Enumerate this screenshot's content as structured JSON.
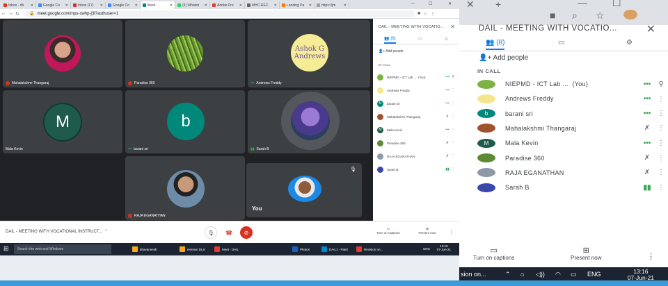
{
  "browser": {
    "tabs": [
      {
        "label": "Inbox - dh",
        "color": "#d93025"
      },
      {
        "label": "Google Co",
        "color": "#4285f4"
      },
      {
        "label": "Inbox (17)",
        "color": "#d93025"
      },
      {
        "label": "Google Co",
        "color": "#4285f4"
      },
      {
        "label": "Meet -",
        "color": "#00897b"
      },
      {
        "label": "(9) Whatsh",
        "color": "#25d366"
      },
      {
        "label": "Adobe Pro",
        "color": "#e53935"
      },
      {
        "label": "MHC-REC",
        "color": "#616161"
      },
      {
        "label": "Landing Pa",
        "color": "#f57c00"
      },
      {
        "label": "https://jm",
        "color": "#9e9e9e"
      }
    ],
    "url": "meet.google.com/mps-swhp-j3l?authuser=1"
  },
  "meet": {
    "tiles": [
      {
        "name": "Mahalakshmi Thangaraj",
        "status": "muted"
      },
      {
        "name": "Paradise 360",
        "status": "muted"
      },
      {
        "name": "Andrews Freddy",
        "status": "talking",
        "avatar_text": "Ashok G Andrews"
      },
      {
        "name": "Mala Kevin",
        "status": "none",
        "initial": "M"
      },
      {
        "name": "barani sri",
        "status": "talking",
        "initial": "b"
      },
      {
        "name": "Sarah B",
        "status": "speaking"
      },
      {
        "name": "RAJA EGANATHAN",
        "status": "muted"
      },
      {
        "name": "You",
        "status": "none"
      }
    ],
    "meeting_title": "DAIL - MEETING WITH VOCATIONAL INSTRUCT...",
    "captions_label": "Turn on captions",
    "present_label": "Present now"
  },
  "panel": {
    "title": "DAIL - MEETING WITH VOCATIO...",
    "people_count": "(8)",
    "add_people": "Add people",
    "in_call": "IN CALL",
    "participants": [
      {
        "name": "NIEPMD - ICT Lab ...",
        "suffix": "(You)",
        "status": "•••",
        "av_color": "#7cb342",
        "initial": "",
        "icon": "pin"
      },
      {
        "name": "Andrews Freddy",
        "suffix": "",
        "status": "•••",
        "av_color": "#f4e78b",
        "initial": "",
        "icon": "more"
      },
      {
        "name": "barani sri",
        "suffix": "",
        "status": "•••",
        "av_color": "#00897b",
        "initial": "b",
        "icon": "more"
      },
      {
        "name": "Mahalakshmi Thangaraj",
        "suffix": "",
        "status": "muted",
        "av_color": "#a0522d",
        "initial": "",
        "icon": "more"
      },
      {
        "name": "Mala Kevin",
        "suffix": "",
        "status": "•••",
        "av_color": "#1e5b4a",
        "initial": "M",
        "icon": "more"
      },
      {
        "name": "Paradise 360",
        "suffix": "",
        "status": "muted",
        "av_color": "#5d8a35",
        "initial": "",
        "icon": "more"
      },
      {
        "name": "RAJA EGANATHAN",
        "suffix": "",
        "status": "muted",
        "av_color": "#8d9aa5",
        "initial": "",
        "icon": "more"
      },
      {
        "name": "Sarah B",
        "suffix": "",
        "status": "speaking",
        "av_color": "#3949ab",
        "initial": "",
        "icon": "more"
      }
    ]
  },
  "taskbar": {
    "search_placeholder": "Search the web and Windows",
    "items": [
      "bhavaneesh",
      "revision DLS",
      "Meet - DAIL",
      "Photos",
      "DAIL1 - Paint",
      "Revision on..."
    ],
    "lang": "ENG",
    "time": "13:16",
    "date": "07-Jun-21"
  },
  "right_taskbar": {
    "partial_item": "sion on...",
    "lang": "ENG",
    "time": "13:16",
    "date": "07-Jun-21"
  }
}
